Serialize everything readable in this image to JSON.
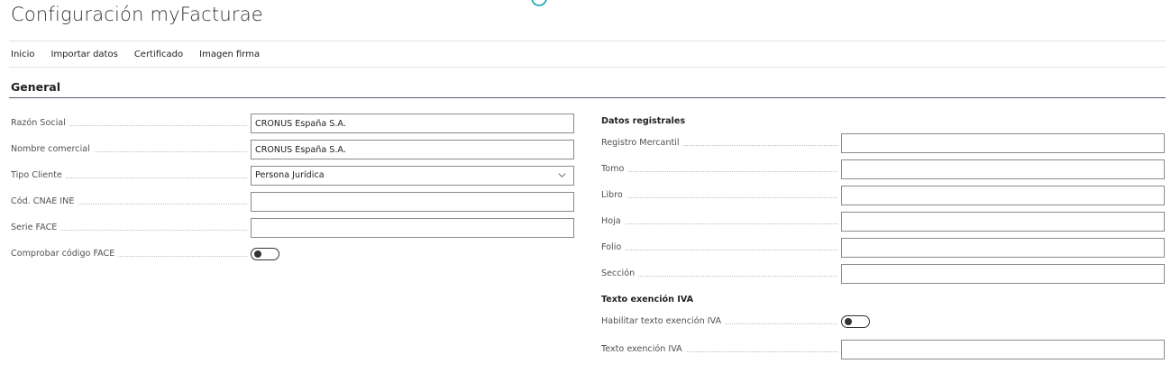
{
  "page": {
    "title": "Configuración myFacturae"
  },
  "actions": [
    {
      "label": "Inicio"
    },
    {
      "label": "Importar datos"
    },
    {
      "label": "Certificado"
    },
    {
      "label": "Imagen firma"
    }
  ],
  "section": {
    "title": "General"
  },
  "left_fields": {
    "razon_social": {
      "label": "Razón Social",
      "value": "CRONUS España S.A."
    },
    "nombre_comercial": {
      "label": "Nombre comercial",
      "value": "CRONUS España S.A."
    },
    "tipo_cliente": {
      "label": "Tipo Cliente",
      "value": "Persona Jurídica"
    },
    "cod_cnae": {
      "label": "Cód. CNAE INE",
      "value": ""
    },
    "serie_face": {
      "label": "Serie FACE",
      "value": ""
    },
    "comprobar_face": {
      "label": "Comprobar código FACE",
      "enabled": false
    }
  },
  "right_groups": {
    "datos_registrales": {
      "title": "Datos registrales",
      "fields": [
        {
          "label": "Registro Mercantil",
          "value": ""
        },
        {
          "label": "Tomo",
          "value": ""
        },
        {
          "label": "Libro",
          "value": ""
        },
        {
          "label": "Hoja",
          "value": ""
        },
        {
          "label": "Folio",
          "value": ""
        },
        {
          "label": "Sección",
          "value": ""
        }
      ]
    },
    "texto_exencion": {
      "title": "Texto exención IVA",
      "habilitar": {
        "label": "Habilitar texto exención IVA",
        "enabled": false
      },
      "texto": {
        "label": "Texto exención IVA",
        "value": ""
      }
    }
  },
  "icons": {
    "spinner": "loading-spinner-icon",
    "dropdown": "chevron-down-icon"
  },
  "colors": {
    "accent": "#00a3b4",
    "section_rule": "#505c6d",
    "input_border": "#8a8a8a"
  }
}
